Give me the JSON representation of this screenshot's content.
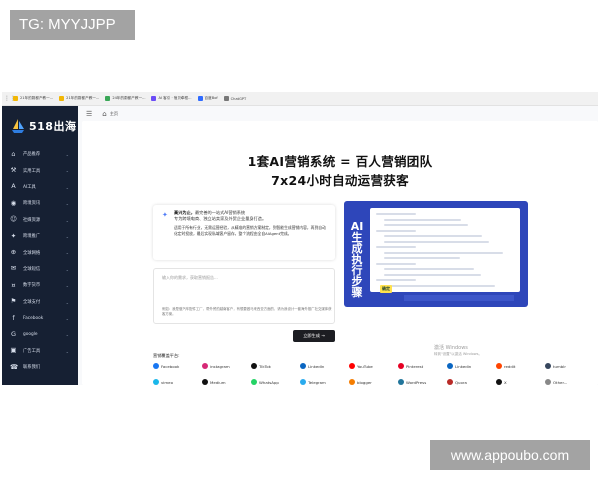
{
  "watermarks": {
    "top_left": "TG: MYYJJPP",
    "bottom_right": "www.appoubo.com"
  },
  "browser": {
    "tabs": [
      {
        "label": "21年的蔚都产教一...",
        "color": "#f2b705"
      },
      {
        "label": "21年的蔚都产教一...",
        "color": "#f2b705"
      },
      {
        "label": "24年的蔚都产教一...",
        "color": "#3aa757"
      },
      {
        "label": "AI 客引 · 宿贝牵框...",
        "color": "#6b4cf6"
      },
      {
        "label": "百度Bof",
        "color": "#2f6bff"
      },
      {
        "label": "ChatGPT",
        "color": "#777777"
      }
    ]
  },
  "sidebar": {
    "brand": "518出海",
    "items": [
      {
        "label": "产品推荐",
        "icon": "home-icon",
        "glyph": "⌂"
      },
      {
        "label": "实用工具",
        "icon": "tools-icon",
        "glyph": "⚒"
      },
      {
        "label": "AI工具",
        "icon": "ai-icon",
        "glyph": "A"
      },
      {
        "label": "跨境资讯",
        "icon": "globe-icon",
        "glyph": "◉"
      },
      {
        "label": "社媒资源",
        "icon": "social-icon",
        "glyph": "☺"
      },
      {
        "label": "跨境推广",
        "icon": "megaphone-icon",
        "glyph": "✦"
      },
      {
        "label": "全球网络",
        "icon": "network-icon",
        "glyph": "⊕"
      },
      {
        "label": "全球短信",
        "icon": "sms-icon",
        "glyph": "✉"
      },
      {
        "label": "数字货币",
        "icon": "coin-icon",
        "glyph": "¤"
      },
      {
        "label": "全球支付",
        "icon": "payment-icon",
        "glyph": "⚑"
      },
      {
        "label": "Facebook",
        "icon": "facebook-icon",
        "glyph": "f"
      },
      {
        "label": "google",
        "icon": "google-icon",
        "glyph": "G"
      },
      {
        "label": "广告工具",
        "icon": "ad-icon",
        "glyph": "▣"
      },
      {
        "label": "联系我们",
        "icon": "contact-icon",
        "glyph": "☎"
      }
    ]
  },
  "breadcrumb": {
    "home": "主页"
  },
  "hero": {
    "line1": "1套AI营销系统 = 百人营销团队",
    "line2": "7x24小时自动运营获客",
    "image_title": "AI生成执行步骤",
    "image_badge": "确定"
  },
  "intro": {
    "line1_strong": "高兴为止，",
    "line1": "最完善的一站式AI营销系统",
    "line2": "专为跨境电商、独立站卖家及外贸企业量身打造。",
    "para": "适用于所有行业，无需运营经验，从精准的营销方案制定，到智能生成营销内容，再到自动化定时投放，最后实现私域客户留存，整个流程由全自AIAgent完成。"
  },
  "prompt": {
    "placeholder": "输入你的需求，获取营销报告...",
    "example": "例如：我是做汽车配件工厂，帮外贸的越南客户，有想要做马来西亚方面的，请为我设计一套海外推广社交媒体获客方案。"
  },
  "generate_button": "立即生成 →",
  "platforms": {
    "title": "营销覆盖平台:",
    "row1": [
      {
        "name": "Facebook",
        "icon": "facebook-icon",
        "color": "#1877f2"
      },
      {
        "name": "instagram",
        "icon": "instagram-icon",
        "color": "#d62976"
      },
      {
        "name": "TikTok",
        "icon": "tiktok-icon",
        "color": "#111111"
      },
      {
        "name": "LinkedIn",
        "icon": "linkedin-icon",
        "color": "#0a66c2"
      },
      {
        "name": "YouTube",
        "icon": "youtube-icon",
        "color": "#ff0000"
      },
      {
        "name": "Pinterest",
        "icon": "pinterest-icon",
        "color": "#e60023"
      },
      {
        "name": "Linkedin",
        "icon": "linkedin-icon-2",
        "color": "#0a66c2"
      },
      {
        "name": "reddit",
        "icon": "reddit-icon",
        "color": "#ff4500"
      },
      {
        "name": "tumblr",
        "icon": "tumblr-icon",
        "color": "#36465d"
      }
    ],
    "row2": [
      {
        "name": "vimeo",
        "icon": "vimeo-icon",
        "color": "#1ab7ea"
      },
      {
        "name": "Medium",
        "icon": "medium-icon",
        "color": "#111111"
      },
      {
        "name": "WhatsApp",
        "icon": "whatsapp-icon",
        "color": "#25d366"
      },
      {
        "name": "Telegram",
        "icon": "telegram-icon",
        "color": "#2aabee"
      },
      {
        "name": "blogger",
        "icon": "blogger-icon",
        "color": "#f57d00"
      },
      {
        "name": "WordPress",
        "icon": "wordpress-icon",
        "color": "#21759b"
      },
      {
        "name": "Quora",
        "icon": "quora-icon",
        "color": "#b92b27"
      },
      {
        "name": "X",
        "icon": "x-icon",
        "color": "#111111"
      },
      {
        "name": "Other...",
        "icon": "more-icon",
        "color": "#888888"
      }
    ]
  },
  "windows_activation": {
    "line1": "激活 Windows",
    "line2": "转到\"设置\"以激活 Windows。"
  }
}
